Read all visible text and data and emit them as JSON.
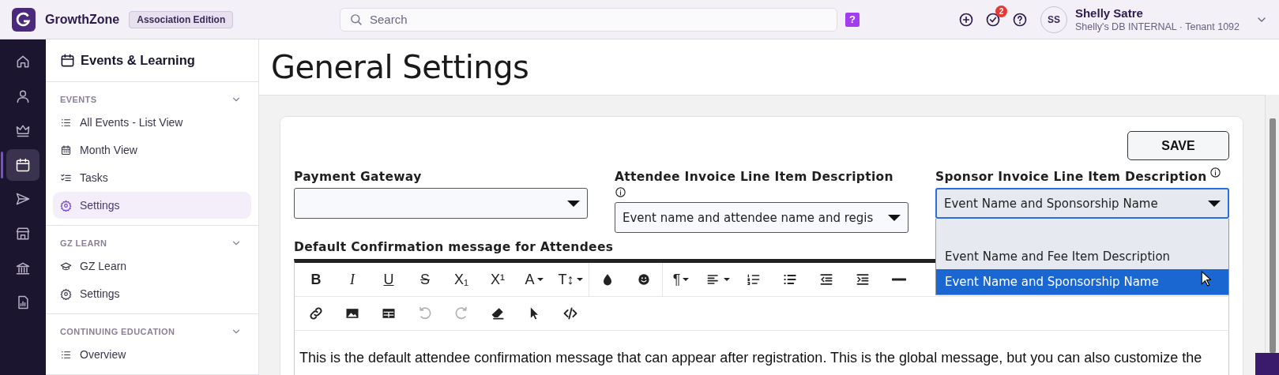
{
  "app": {
    "name": "GrowthZone",
    "edition": "Association Edition"
  },
  "search": {
    "placeholder": "Search"
  },
  "help_badge": "?",
  "notifications": {
    "count": "2"
  },
  "user": {
    "initials": "SS",
    "name": "Shelly Satre",
    "subtitle": "Shelly's DB INTERNAL · Tenant 1092"
  },
  "rail": [
    {
      "kind": "home",
      "selected": false
    },
    {
      "kind": "person",
      "selected": false
    },
    {
      "kind": "crown",
      "selected": false
    },
    {
      "kind": "calendar",
      "selected": true
    },
    {
      "kind": "send",
      "selected": false
    },
    {
      "kind": "store",
      "selected": false
    },
    {
      "kind": "bank",
      "selected": false
    },
    {
      "kind": "report",
      "selected": false
    }
  ],
  "sidebar": {
    "title": "Events & Learning",
    "sections": [
      {
        "label": "EVENTS",
        "expanded": true,
        "items": [
          {
            "label": "All Events - List View",
            "kind": "list",
            "selected": false
          },
          {
            "label": "Month View",
            "kind": "month",
            "selected": false
          },
          {
            "label": "Tasks",
            "kind": "tasks",
            "selected": false
          },
          {
            "label": "Settings",
            "kind": "gear",
            "selected": true
          }
        ]
      },
      {
        "label": "GZ LEARN",
        "expanded": true,
        "items": [
          {
            "label": "GZ Learn",
            "kind": "cap",
            "selected": false
          },
          {
            "label": "Settings",
            "kind": "gear",
            "selected": false
          }
        ]
      },
      {
        "label": "CONTINUING EDUCATION",
        "expanded": true,
        "items": [
          {
            "label": "Overview",
            "kind": "list",
            "selected": false
          }
        ]
      }
    ]
  },
  "page": {
    "title": "General Settings"
  },
  "save_button": "SAVE",
  "fields": [
    {
      "label": "Payment Gateway",
      "kind": "plain",
      "expanded": false
    },
    {
      "label": "Attendee Invoice Line Item Description",
      "kind": "info-below",
      "value": "Event name and attendee name and regis",
      "expanded": false
    },
    {
      "label": "Sponsor Invoice Line Item Description",
      "kind": "info-inline",
      "value": "Event Name and Sponsorship Name",
      "expanded": true,
      "options": [
        {
          "selected": false
        },
        {
          "label": "Event Name and Fee Item Description",
          "selected": false
        },
        {
          "label": "Event Name and Sponsorship Name",
          "selected": true
        }
      ]
    }
  ],
  "editor": {
    "label": "Default Confirmation message for Attendees",
    "toolbar": [
      [
        [
          {
            "kind": "bold",
            "glyph": "B",
            "disabled": false
          },
          {
            "kind": "italic",
            "glyph": "I",
            "disabled": false
          },
          {
            "kind": "underline",
            "glyph": "U",
            "disabled": false
          },
          {
            "kind": "strike",
            "glyph": "S",
            "disabled": false
          },
          {
            "kind": "plain",
            "glyph": "X₁",
            "disabled": false
          },
          {
            "kind": "plain",
            "glyph": "X¹",
            "disabled": false
          },
          {
            "kind": "plain",
            "glyph": "A",
            "dropdown": true,
            "disabled": false
          },
          {
            "kind": "plain",
            "glyph": "T↕",
            "dropdown": true,
            "disabled": false
          }
        ],
        [
          {
            "kind": "drop",
            "disabled": false
          },
          {
            "kind": "smiley",
            "disabled": false
          }
        ],
        [
          {
            "kind": "plain",
            "glyph": "¶",
            "dropdown": true,
            "disabled": false
          },
          {
            "kind": "align",
            "dropdown": true,
            "disabled": false
          },
          {
            "kind": "ordered",
            "disabled": false
          },
          {
            "kind": "bullets",
            "disabled": false
          },
          {
            "kind": "outdent",
            "disabled": false
          },
          {
            "kind": "indent",
            "disabled": false
          },
          {
            "kind": "rule",
            "disabled": false
          }
        ]
      ],
      [
        [
          {
            "kind": "link",
            "disabled": false
          },
          {
            "kind": "image",
            "disabled": false
          },
          {
            "kind": "table",
            "disabled": false
          },
          {
            "kind": "undo",
            "disabled": true
          },
          {
            "kind": "redo",
            "disabled": true
          },
          {
            "kind": "eraser",
            "disabled": false
          },
          {
            "kind": "pointer",
            "disabled": false
          },
          {
            "kind": "code",
            "disabled": false
          }
        ]
      ]
    ],
    "text": "This is the default attendee confirmation message that can appear after registration. This is the global message, but you can also customize the"
  }
}
